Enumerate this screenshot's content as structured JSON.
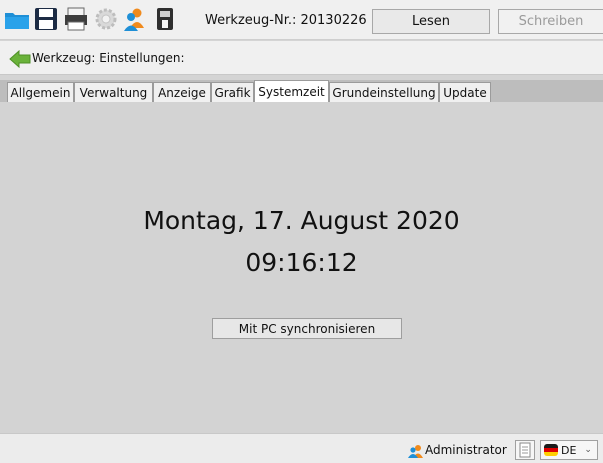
{
  "toolbar": {
    "buttons": [
      {
        "name": "open-folder-icon"
      },
      {
        "name": "save-icon"
      },
      {
        "name": "print-icon"
      },
      {
        "name": "settings-gear-icon"
      },
      {
        "name": "users-icon"
      },
      {
        "name": "device-icon"
      }
    ],
    "tool_label": "Werkzeug-Nr.: 20130226",
    "read_label": "Lesen",
    "write_label": "Schreiben"
  },
  "nav": {
    "title": "Werkzeug: Einstellungen:"
  },
  "tabs": [
    {
      "label": "Allgemein",
      "active": false
    },
    {
      "label": "Verwaltung",
      "active": false
    },
    {
      "label": "Anzeige",
      "active": false
    },
    {
      "label": "Grafik",
      "active": false
    },
    {
      "label": "Systemzeit",
      "active": true
    },
    {
      "label": "Grundeinstellung",
      "active": false
    },
    {
      "label": "Update",
      "active": false
    }
  ],
  "systemtime": {
    "date": "Montag, 17. August 2020",
    "time": "09:16:12",
    "sync_label": "Mit PC synchronisieren"
  },
  "status": {
    "user": "Administrator",
    "language": "DE"
  },
  "colors": {
    "accent_green": "#6ab23a",
    "folder_blue": "#1f8fd6",
    "user_orange": "#f08a1c"
  }
}
